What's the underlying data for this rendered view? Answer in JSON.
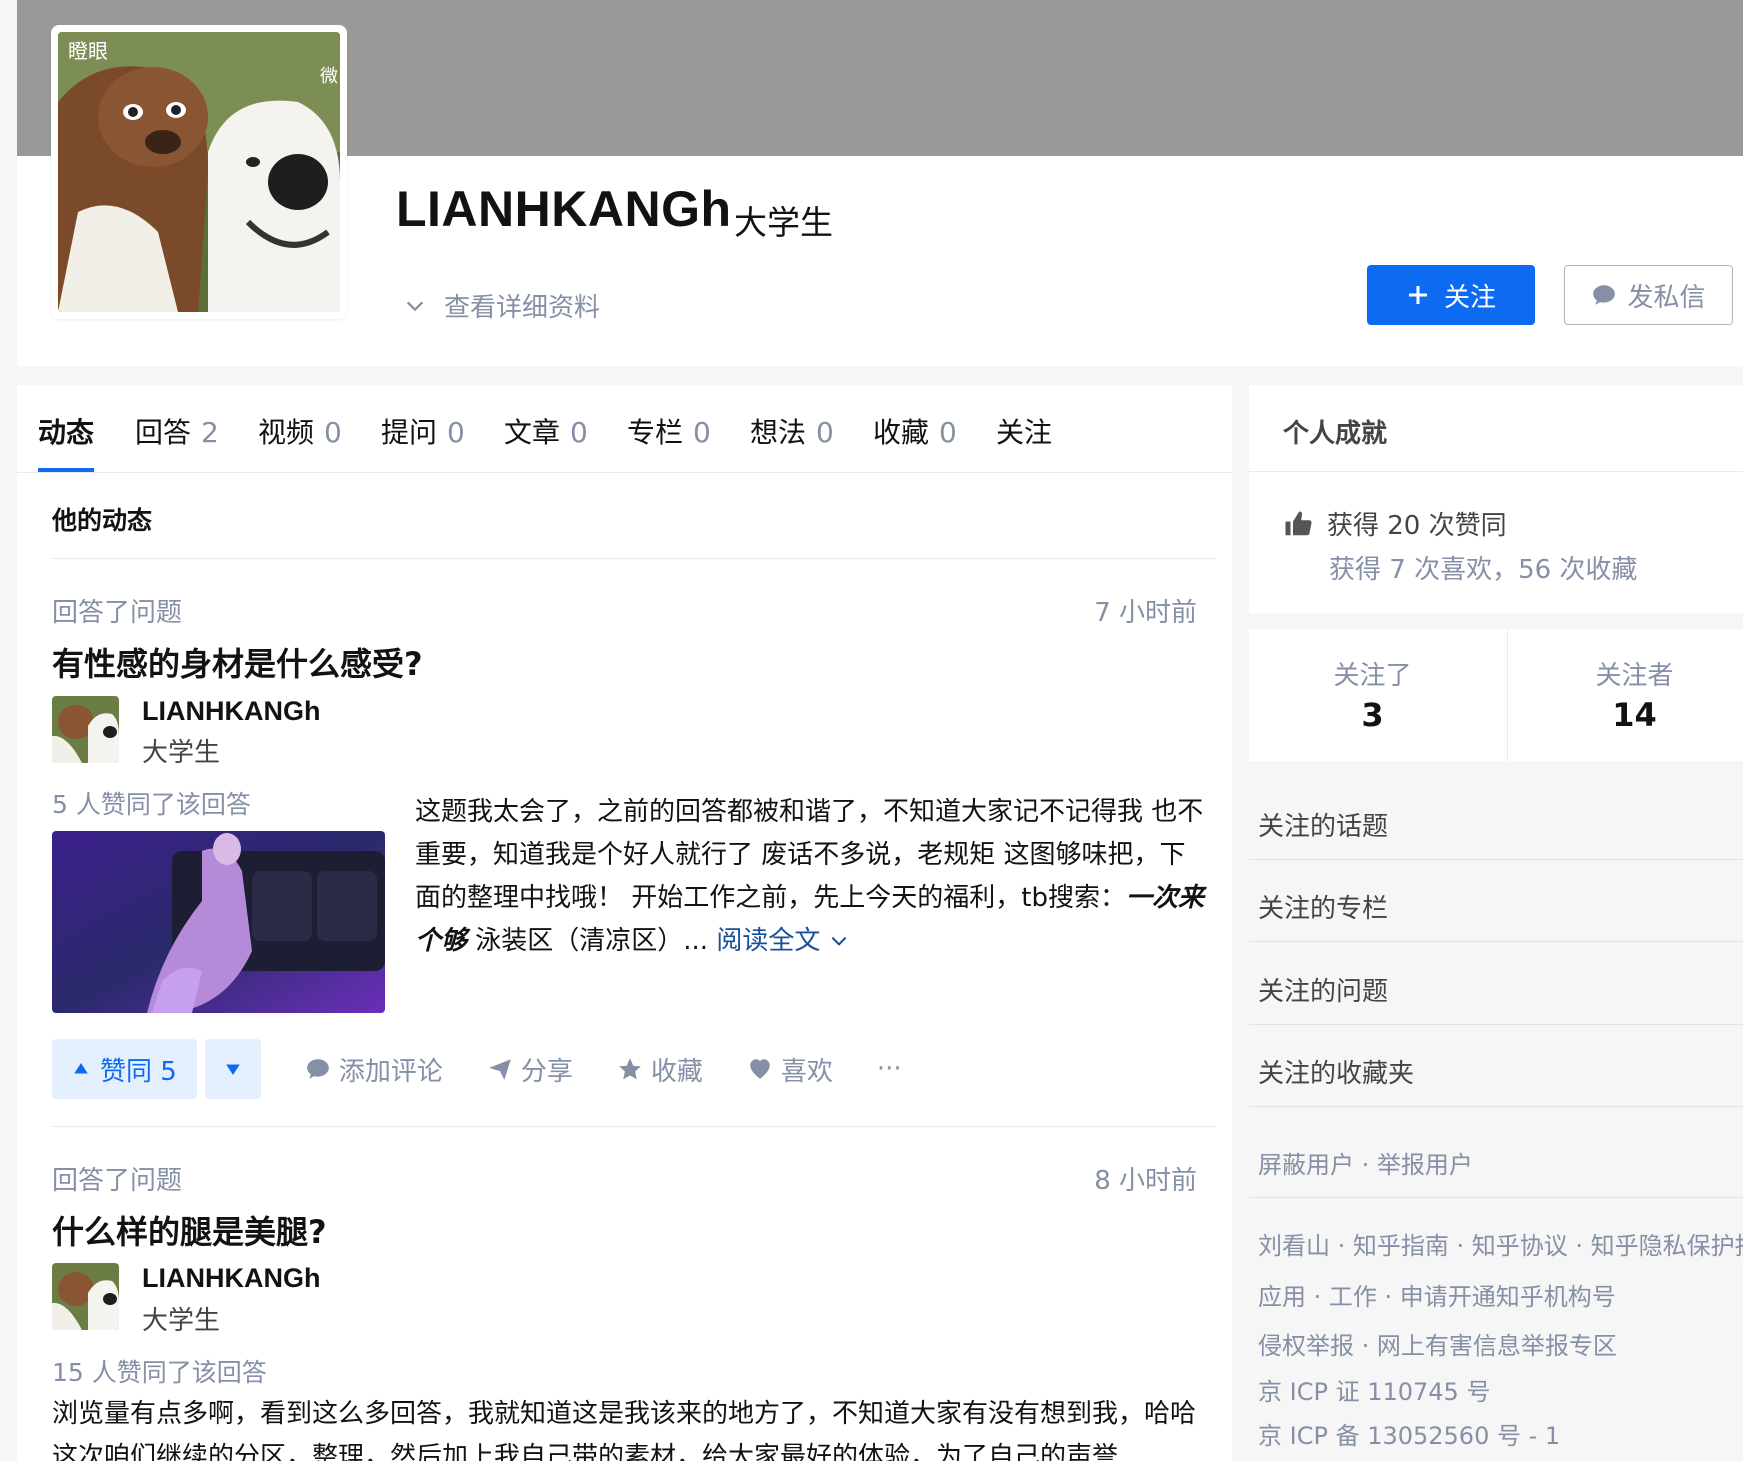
{
  "profile": {
    "name": "LIANHKANGh",
    "headline": "大学生",
    "detail_link": "查看详细资料",
    "follow_button": "关注",
    "message_button": "发私信",
    "avatar_caption": "瞪眼",
    "avatar_caption_right": "微"
  },
  "tabs": [
    {
      "label": "动态",
      "count": ""
    },
    {
      "label": "回答",
      "count": "2"
    },
    {
      "label": "视频",
      "count": "0"
    },
    {
      "label": "提问",
      "count": "0"
    },
    {
      "label": "文章",
      "count": "0"
    },
    {
      "label": "专栏",
      "count": "0"
    },
    {
      "label": "想法",
      "count": "0"
    },
    {
      "label": "收藏",
      "count": "0"
    },
    {
      "label": "关注",
      "count": ""
    }
  ],
  "feed": {
    "section_title": "他的动态",
    "items": [
      {
        "action": "回答了问题",
        "time": "7 小时前",
        "question": "有性感的身材是什么感受?",
        "author_name": "LIANHKANGh",
        "author_headline": "大学生",
        "votes_text": "5 人赞同了该回答",
        "excerpt": "这题我太会了，之前的回答都被和谐了，不知道大家记不记得我 也不重要，知道我是个好人就行了 废话不多说，老规矩 这图够味把，下面的整理中找哦！ 开始工作之前，先上今天的福利，tb搜索：",
        "excerpt_emph": "一次来个够",
        "excerpt_tail": " 泳装区（清凉区）...",
        "read_more": "阅读全文",
        "vote_up_label": "赞同 5",
        "comment_label": "添加评论",
        "share_label": "分享",
        "collect_label": "收藏",
        "like_label": "喜欢",
        "more_label": "···"
      },
      {
        "action": "回答了问题",
        "time": "8 小时前",
        "question": "什么样的腿是美腿?",
        "author_name": "LIANHKANGh",
        "author_headline": "大学生",
        "votes_text": "15 人赞同了该回答",
        "excerpt": "浏览量有点多啊，看到这么多回答，我就知道这是我该来的地方了，不知道大家有没有想到我，哈哈 这次咱们继续的分区，整理，然后加上我自己带的素材，给大家最好的体验，为了自己的声誉"
      }
    ]
  },
  "sidebar": {
    "achievements_title": "个人成就",
    "likes_received": "获得 20 次赞同",
    "likes_and_collects": "获得 7 次喜欢，56 次收藏",
    "following_label": "关注了",
    "following_count": "3",
    "followers_label": "关注者",
    "followers_count": "14",
    "links": [
      "关注的话题",
      "关注的专栏",
      "关注的问题",
      "关注的收藏夹"
    ],
    "block_report": "屏蔽用户 · 举报用户",
    "footer": [
      "刘看山 · 知乎指南 · 知乎协议 · 知乎隐私保护指引",
      "应用 · 工作 · 申请开通知乎机构号",
      "侵权举报 · 网上有害信息举报专区",
      "京 ICP 证 110745 号",
      "京 ICP 备 13052560 号 - 1"
    ]
  },
  "colors": {
    "brand_blue": "#0d6bf2",
    "cover_gray": "#999999",
    "muted_text": "#8590a6"
  }
}
